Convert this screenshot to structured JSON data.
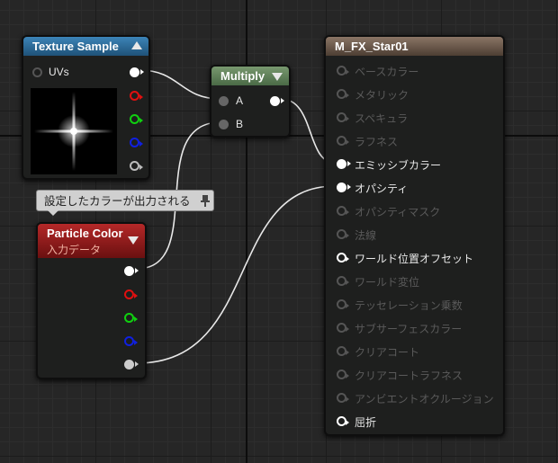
{
  "texture_node": {
    "title": "Texture Sample",
    "input_label": "UVs"
  },
  "multiply_node": {
    "title": "Multiply",
    "input_a": "A",
    "input_b": "B"
  },
  "tooltip": {
    "text": "設定したカラーが出力される"
  },
  "particle_node": {
    "title": "Particle Color",
    "subtitle": "入力データ"
  },
  "material_node": {
    "title": "M_FX_Star01",
    "inputs": [
      {
        "label": "ベースカラー",
        "active": false
      },
      {
        "label": "メタリック",
        "active": false
      },
      {
        "label": "スペキュラ",
        "active": false
      },
      {
        "label": "ラフネス",
        "active": false
      },
      {
        "label": "エミッシブカラー",
        "active": true
      },
      {
        "label": "オパシティ",
        "active": true
      },
      {
        "label": "オパシティマスク",
        "active": false
      },
      {
        "label": "法線",
        "active": false
      },
      {
        "label": "ワールド位置オフセット",
        "active": true
      },
      {
        "label": "ワールド変位",
        "active": false
      },
      {
        "label": "テッセレーション乗数",
        "active": false
      },
      {
        "label": "サブサーフェスカラー",
        "active": false
      },
      {
        "label": "クリアコート",
        "active": false
      },
      {
        "label": "クリアコートラフネス",
        "active": false
      },
      {
        "label": "アンビエントオクルージョン",
        "active": false
      },
      {
        "label": "屈折",
        "active": true
      }
    ]
  },
  "colors": {
    "texture_header": "#2a6a94",
    "multiply_header": "#5d7a5a",
    "particle_header": "#8f1a1a",
    "material_header": "#6b5a4c",
    "wire": "#e8e8e8"
  }
}
